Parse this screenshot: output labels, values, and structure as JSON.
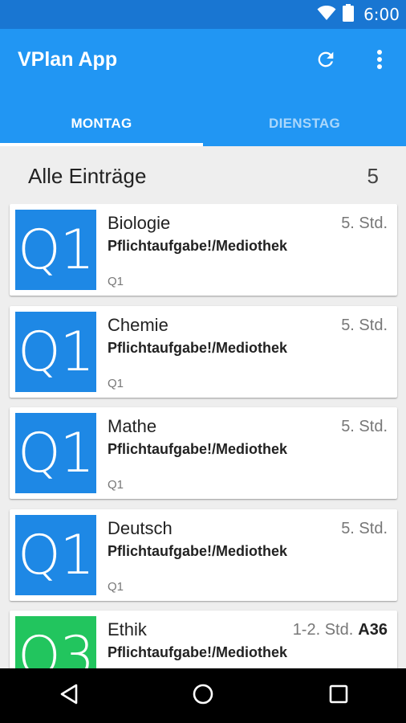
{
  "status_bar": {
    "time": "6:00",
    "icons": [
      "wifi-icon",
      "battery-icon"
    ],
    "color": "#1976d2"
  },
  "app_bar": {
    "title": "VPlan App",
    "color": "#2196f3",
    "actions": [
      "refresh-icon",
      "more-vert-icon"
    ],
    "tabs": [
      {
        "label": "MONTAG",
        "selected": true
      },
      {
        "label": "DIENSTAG",
        "selected": false
      }
    ]
  },
  "section": {
    "title": "Alle Einträge",
    "count": "5"
  },
  "entries": [
    {
      "badge": "Q1",
      "badge_color": "#1e88e5",
      "subject": "Biologie",
      "time": "5. Std.",
      "room": "",
      "note": "Pflichtaufgabe!/Mediothek",
      "group": "Q1"
    },
    {
      "badge": "Q1",
      "badge_color": "#1e88e5",
      "subject": "Chemie",
      "time": "5. Std.",
      "room": "",
      "note": "Pflichtaufgabe!/Mediothek",
      "group": "Q1"
    },
    {
      "badge": "Q1",
      "badge_color": "#1e88e5",
      "subject": "Mathe",
      "time": "5. Std.",
      "room": "",
      "note": "Pflichtaufgabe!/Mediothek",
      "group": "Q1"
    },
    {
      "badge": "Q1",
      "badge_color": "#1e88e5",
      "subject": "Deutsch",
      "time": "5. Std.",
      "room": "",
      "note": "Pflichtaufgabe!/Mediothek",
      "group": "Q1"
    },
    {
      "badge": "Q3",
      "badge_color": "#22c55e",
      "subject": "Ethik",
      "time": "1-2. Std.",
      "room": "A36",
      "note": "Pflichtaufgabe!/Mediothek",
      "group": ""
    }
  ],
  "nav_bar": {
    "buttons": [
      "back-icon",
      "home-icon",
      "recents-icon"
    ]
  }
}
